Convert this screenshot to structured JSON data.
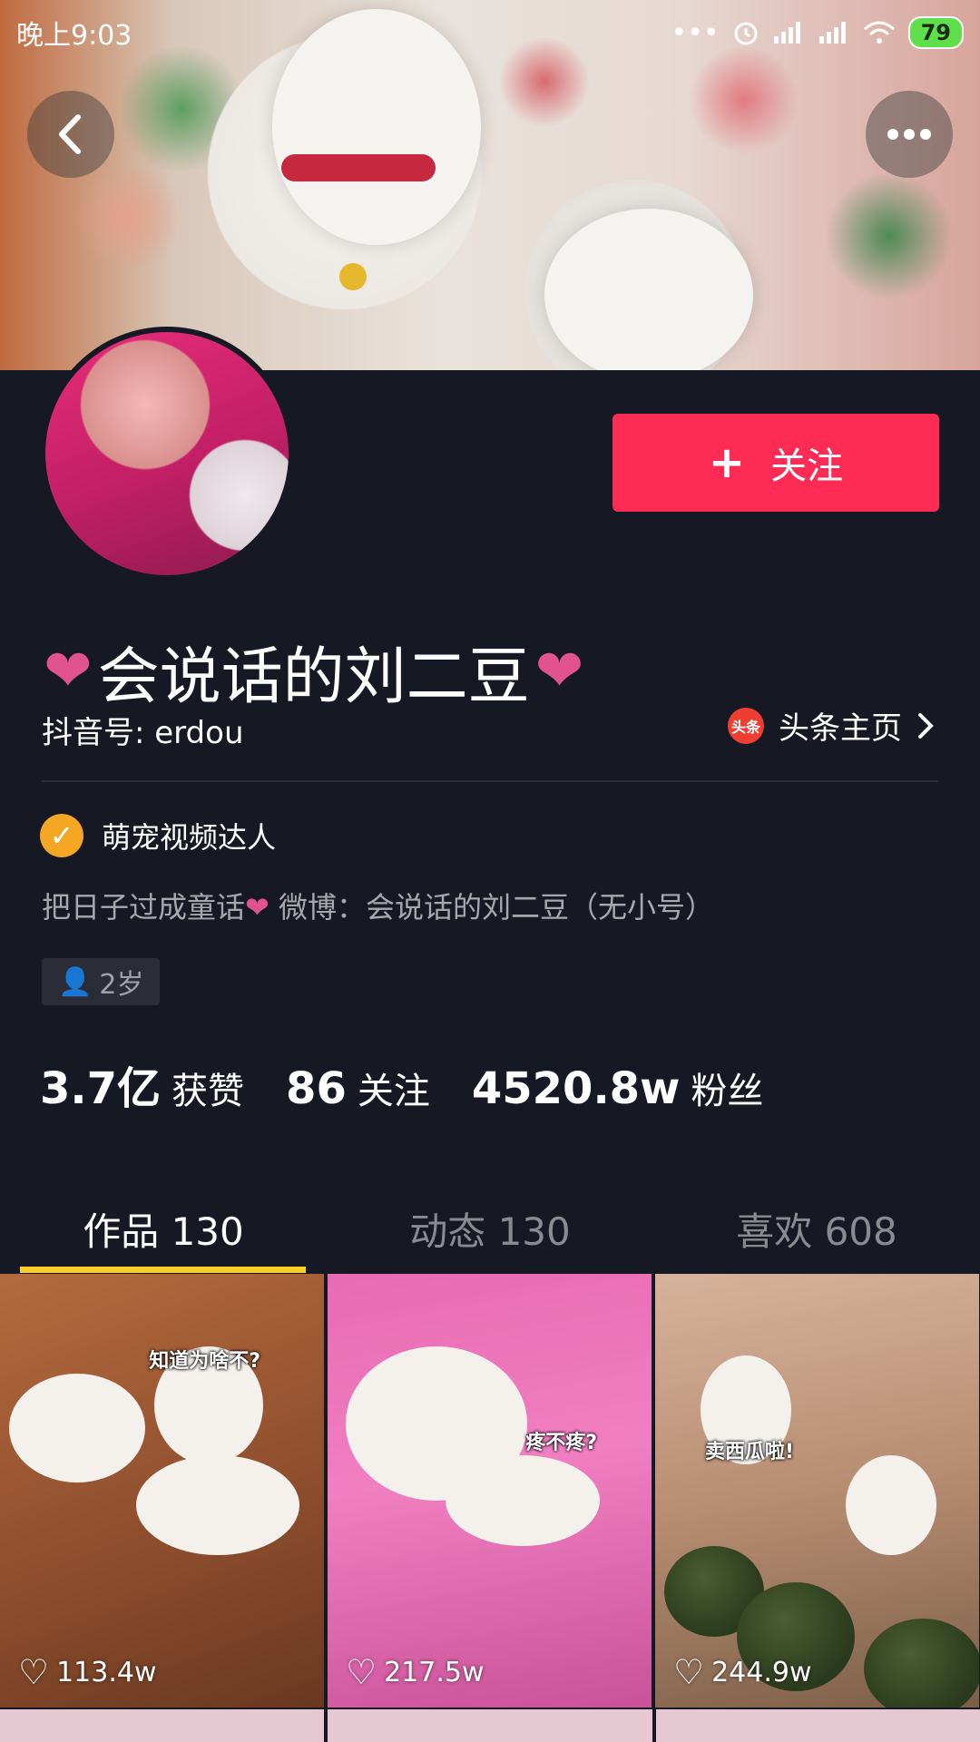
{
  "status_bar": {
    "time": "晚上9:03",
    "battery": "79",
    "icons": [
      "dots-icon",
      "alarm-icon",
      "signal-icon",
      "signal-icon",
      "wifi-icon",
      "battery-icon"
    ]
  },
  "header": {
    "back_icon": "chevron-left-icon",
    "more_icon": "more-dots-icon"
  },
  "profile": {
    "follow_label": "关注",
    "nickname": "会说话的刘二豆",
    "heart": "❤",
    "douyin_id": "抖音号: erdou",
    "toutiao_logo": "头条",
    "toutiao_label": "头条主页",
    "verified_label": "萌宠视频达人",
    "bio_prefix": "把日子过成童话",
    "bio_suffix": " 微博：会说话的刘二豆（无小号）",
    "age": "2岁"
  },
  "stats": [
    {
      "value": "3.7亿",
      "label": "获赞"
    },
    {
      "value": "86",
      "label": "关注"
    },
    {
      "value": "4520.8w",
      "label": "粉丝"
    }
  ],
  "tabs": [
    {
      "label": "作品 130",
      "active": true
    },
    {
      "label": "动态 130",
      "active": false
    },
    {
      "label": "喜欢 608",
      "active": false
    }
  ],
  "videos": [
    {
      "caption": "知道为啥不?",
      "likes": "113.4w"
    },
    {
      "caption": "疼不疼?",
      "likes": "217.5w"
    },
    {
      "caption": "卖西瓜啦!",
      "likes": "244.9w"
    }
  ],
  "colors": {
    "background": "#161823",
    "follow": "#fe2c55",
    "tab_underline": "#facd27",
    "heart": "#e1538f",
    "verified": "#f5a623"
  }
}
